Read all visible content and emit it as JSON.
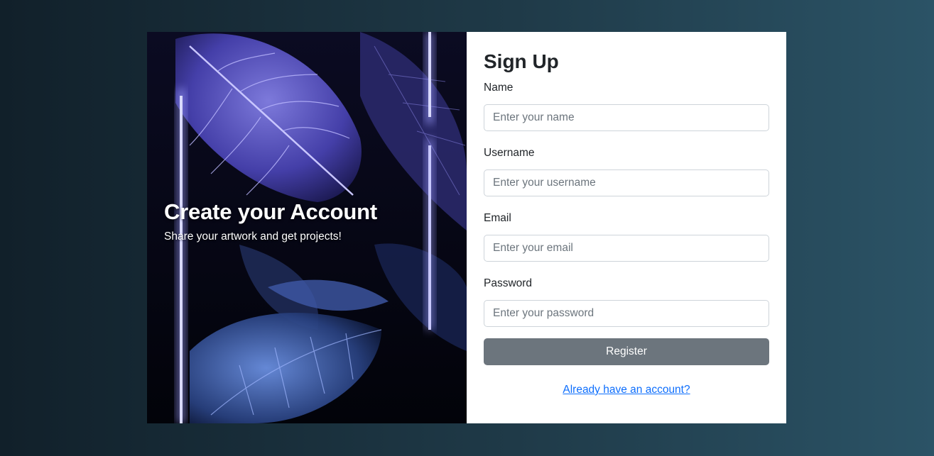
{
  "hero": {
    "title": "Create your Account",
    "subtitle": "Share your artwork and get projects!"
  },
  "form": {
    "title": "Sign Up",
    "fields": [
      {
        "label": "Name",
        "placeholder": "Enter your name",
        "value": ""
      },
      {
        "label": "Username",
        "placeholder": "Enter your username",
        "value": ""
      },
      {
        "label": "Email",
        "placeholder": "Enter your email",
        "value": ""
      },
      {
        "label": "Password",
        "placeholder": "Enter your password",
        "value": ""
      }
    ],
    "register_label": "Register",
    "login_link": "Already have an account?"
  },
  "colors": {
    "button": "#6c757d",
    "link": "#0d6efd",
    "neon": "#7b7bff"
  }
}
